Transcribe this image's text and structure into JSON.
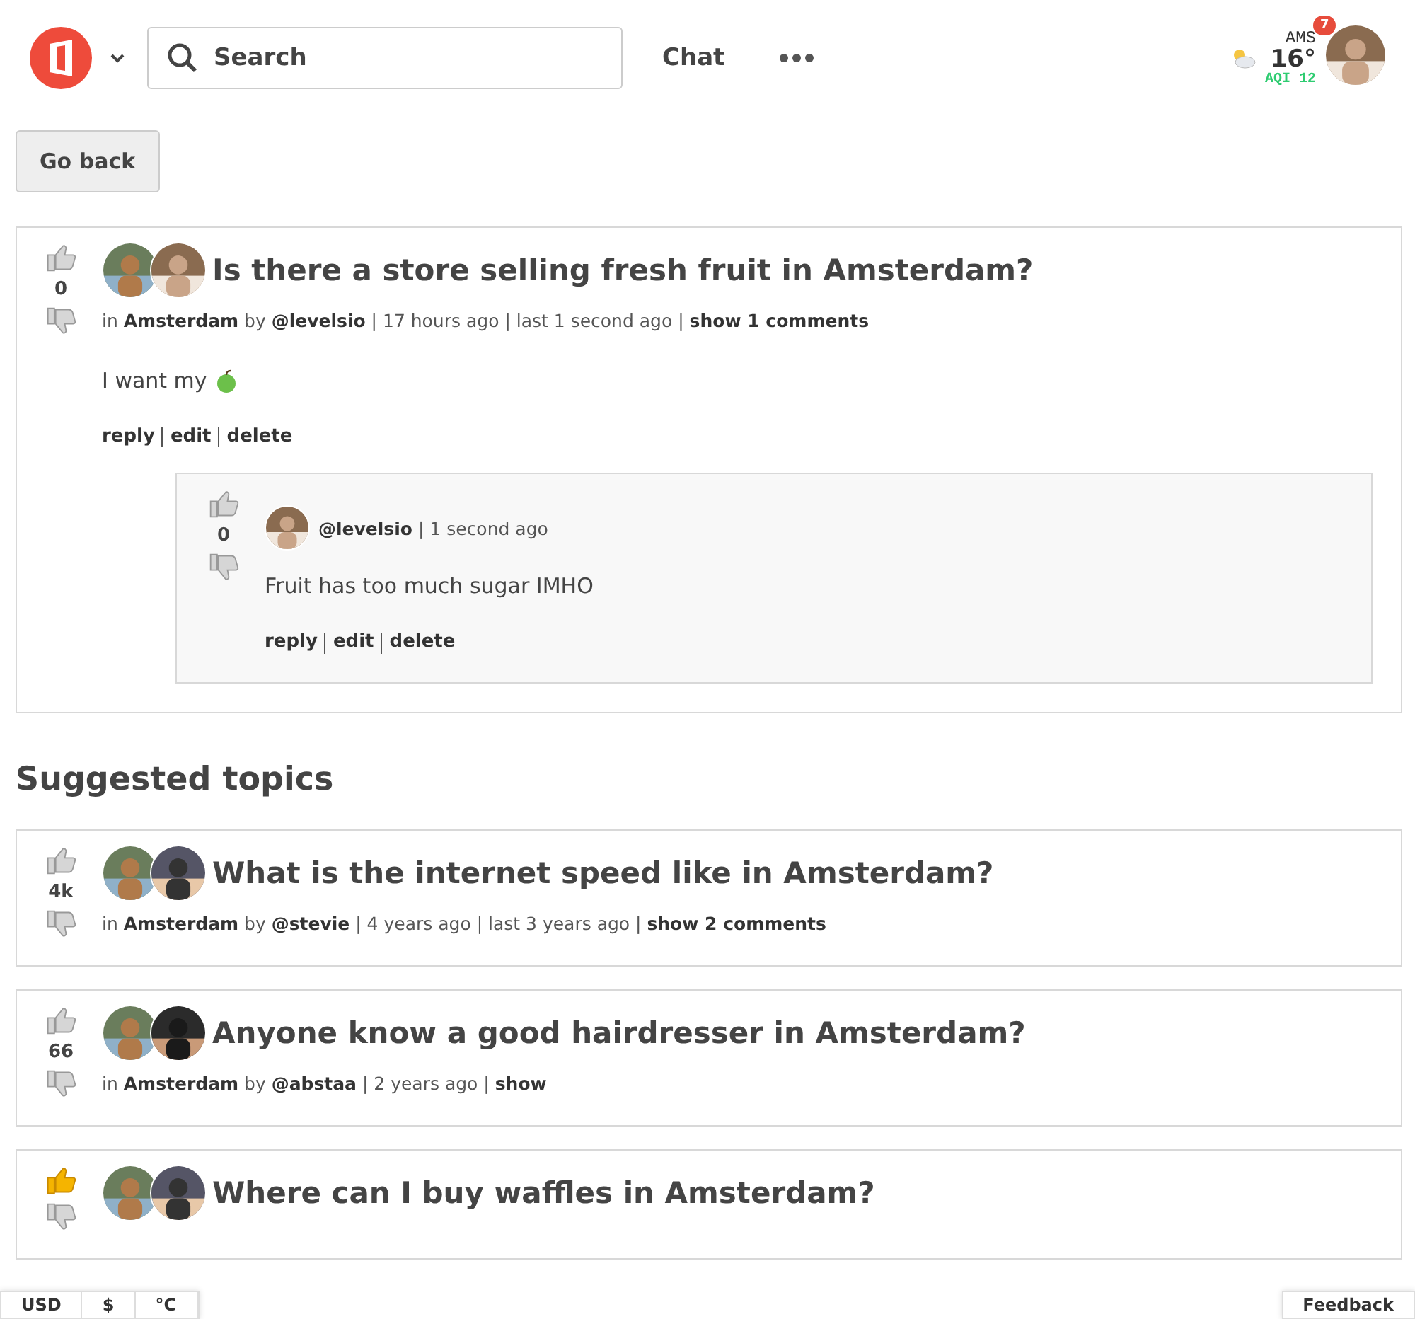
{
  "header": {
    "search": {
      "placeholder": "Search"
    },
    "nav": [
      "Chat"
    ],
    "weather": {
      "city": "AMS",
      "temp": "16°",
      "aqi": "AQI 12"
    },
    "notifications": "7"
  },
  "go_back": "Go back",
  "post": {
    "votes": "0",
    "voted": false,
    "title": "Is there a store selling fresh fruit in Amsterdam?",
    "meta": "in **Amsterdam** by **@levelsio** | 17 hours ago | last 1 second ago | **show 1 comments**",
    "body": "I want my",
    "actions": [
      "reply",
      "edit",
      "delete"
    ],
    "comments": [
      {
        "votes": "0",
        "voted": false,
        "author": "@levelsio",
        "time": "| 1 second ago",
        "body": "Fruit has too much sugar IMHO",
        "actions": [
          "reply",
          "edit",
          "delete"
        ]
      }
    ]
  },
  "suggested_title": "Suggested topics",
  "suggested": [
    {
      "votes": "4k",
      "voted": false,
      "title": "What is the internet speed like in Amsterdam?",
      "meta": "in **Amsterdam** by **@stevie** | 4 years ago | last 3 years ago | **show 2 comments**"
    },
    {
      "votes": "66",
      "voted": false,
      "title": "Anyone know a good hairdresser in Amsterdam?",
      "meta": "in **Amsterdam** by **@abstaa** | 2 years ago | **show**"
    },
    {
      "voted": true,
      "title": "Where can I buy waffles in Amsterdam?"
    }
  ],
  "footer": {
    "currency": "USD",
    "symbol": "$",
    "unit": "°C",
    "feedback": "Feedback"
  }
}
